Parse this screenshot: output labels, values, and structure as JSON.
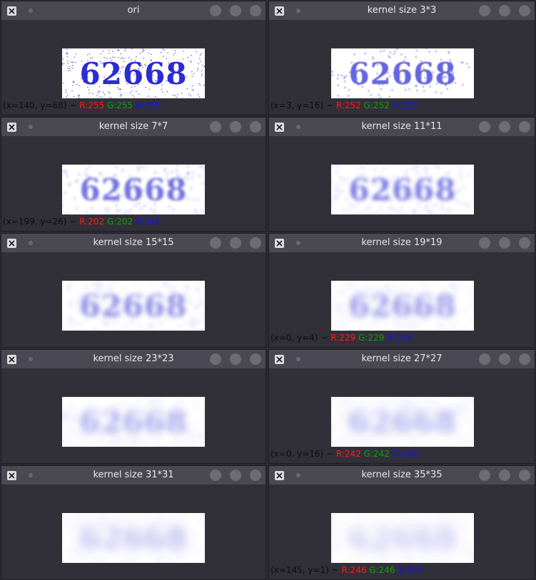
{
  "windows": [
    {
      "title": "ori",
      "blur": 0,
      "dots": "crisp",
      "status": {
        "coord": "(x=140, y=68) ~",
        "r": "R:255",
        "g": "G:255",
        "b": "B:255"
      }
    },
    {
      "title": "kernel size 3*3",
      "blur": 0.8,
      "dots": "light",
      "status": {
        "coord": "(x=3, y=16) ~",
        "r": "R:252",
        "g": "G:252",
        "b": "B:252"
      }
    },
    {
      "title": "kernel size 7*7",
      "blur": 1.8,
      "dots": "light",
      "status": {
        "coord": "(x=199, y=26) ~",
        "r": "R:202",
        "g": "G:202",
        "b": "B:241"
      }
    },
    {
      "title": "kernel size 11*11",
      "blur": 2.6,
      "dots": "light",
      "status": null
    },
    {
      "title": "kernel size 15*15",
      "blur": 3.4,
      "dots": "light",
      "status": null
    },
    {
      "title": "kernel size 19*19",
      "blur": 4.2,
      "dots": "light",
      "status": {
        "coord": "(x=0, y=4) ~",
        "r": "R:229",
        "g": "G:229",
        "b": "B:249"
      }
    },
    {
      "title": "kernel size 23*23",
      "blur": 5.0,
      "dots": "light",
      "status": null
    },
    {
      "title": "kernel size 27*27",
      "blur": 5.8,
      "dots": "light",
      "status": {
        "coord": "(x=0, y=16) ~",
        "r": "R:242",
        "g": "G:242",
        "b": "B:249"
      }
    },
    {
      "title": "kernel size 31*31",
      "blur": 6.6,
      "dots": "light",
      "status": null
    },
    {
      "title": "kernel size 35*35",
      "blur": 7.4,
      "dots": "light",
      "status": {
        "coord": "(x=145, y=1) ~",
        "r": "R:246",
        "g": "G:246",
        "b": "B:249"
      }
    }
  ],
  "captcha_text": "62668",
  "colors": {
    "glyph": "#2c2cd4",
    "glyph_soft": "#5b5bdc",
    "bg_window": "#313038",
    "titlebar": "#4a4953"
  },
  "icons": {
    "app": "x-app-icon",
    "pin": "pin-dot-icon",
    "buttons": [
      "minimize-button-icon",
      "maximize-button-icon",
      "close-button-icon"
    ]
  }
}
